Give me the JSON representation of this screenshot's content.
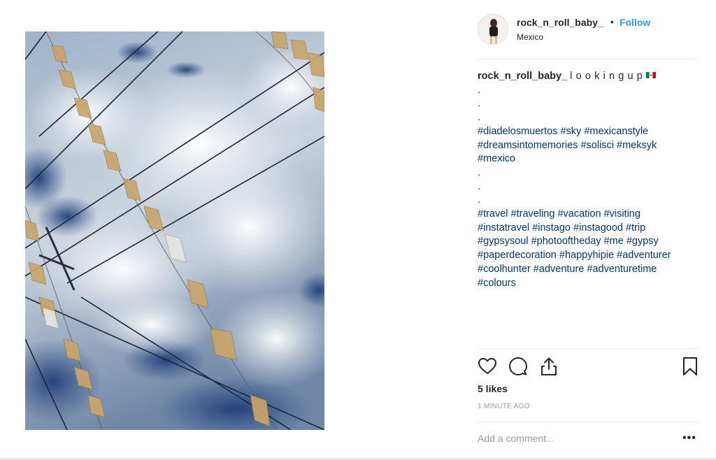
{
  "post": {
    "username": "rock_n_roll_baby_",
    "separator": "•",
    "follow_label": "Follow",
    "location": "Mexico",
    "accent_color": "#3897f0",
    "hashtag_color": "#003569"
  },
  "caption": {
    "username": "rock_n_roll_baby_",
    "title": "lookingup",
    "flag": "mexico-flag-emoji",
    "lines": [
      ".",
      ".",
      ".",
      "#diadelosmuertos #sky #mexicanstyle",
      "#dreamsintomemories #solisci #meksyk",
      "#mexico",
      ".",
      ".",
      ".",
      "#travel #traveling #vacation #visiting",
      "#instatravel #instago #instagood #trip",
      "#gypsysoul #photooftheday #me #gypsy",
      "#paperdecoration #happyhipie #adventurer",
      "#coolhunter #adventure #adventuretime",
      "#colours"
    ]
  },
  "actions": {
    "icons": [
      "heart-icon",
      "comment-icon",
      "share-icon",
      "bookmark-icon"
    ]
  },
  "likes": "5 likes",
  "time_ago": "1 MINUTE AGO",
  "comment": {
    "placeholder": "Add a comment...",
    "more": "•••"
  }
}
